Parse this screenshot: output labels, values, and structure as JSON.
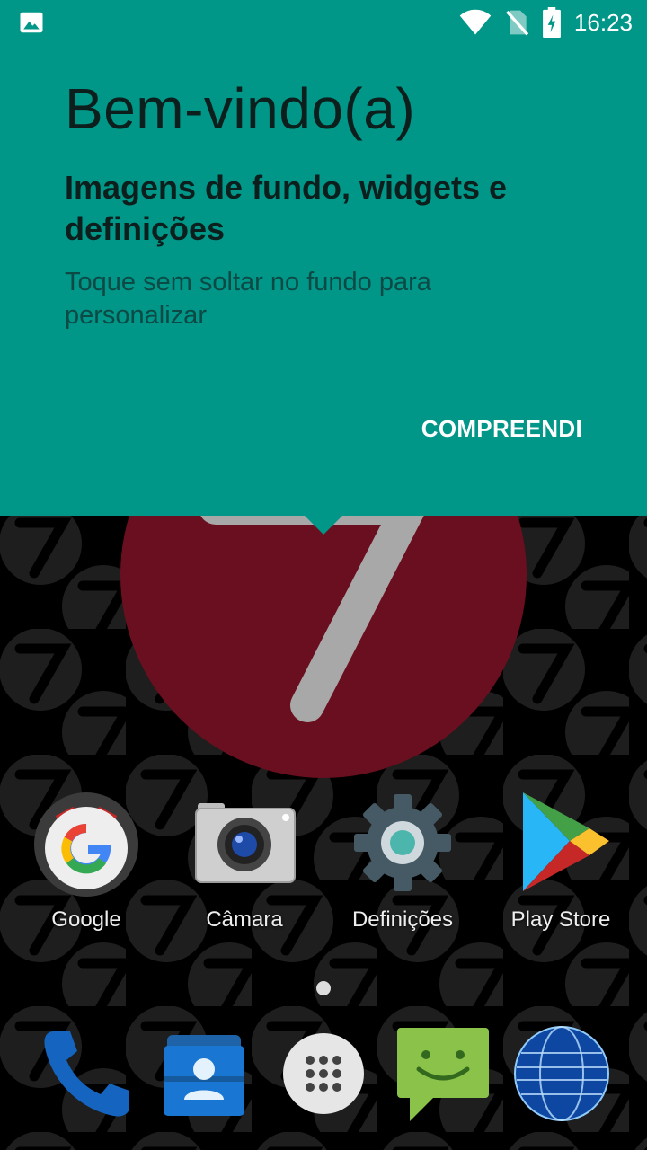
{
  "status_bar": {
    "time": "16:23",
    "icons": [
      "image-icon",
      "wifi-icon",
      "no-sim-icon",
      "battery-charging-icon"
    ]
  },
  "welcome_card": {
    "title": "Bem-vindo(a)",
    "heading": "Imagens de fundo, widgets e definições",
    "body": "Toque sem soltar no fundo para personalizar",
    "button_label": "COMPREENDI",
    "background_color": "#009688"
  },
  "apps": [
    {
      "label": "Google",
      "icon": "google-icon"
    },
    {
      "label": "Câmara",
      "icon": "camera-icon"
    },
    {
      "label": "Definições",
      "icon": "settings-gear-icon"
    },
    {
      "label": "Play Store",
      "icon": "play-store-icon"
    }
  ],
  "dock": [
    {
      "icon": "phone-icon"
    },
    {
      "icon": "contacts-icon"
    },
    {
      "icon": "app-drawer-icon"
    },
    {
      "icon": "messaging-icon"
    },
    {
      "icon": "browser-globe-icon"
    }
  ],
  "wallpaper": {
    "accent_color": "#6a0f1f",
    "pattern_color": "#2a2a2a",
    "numeral": "7"
  }
}
